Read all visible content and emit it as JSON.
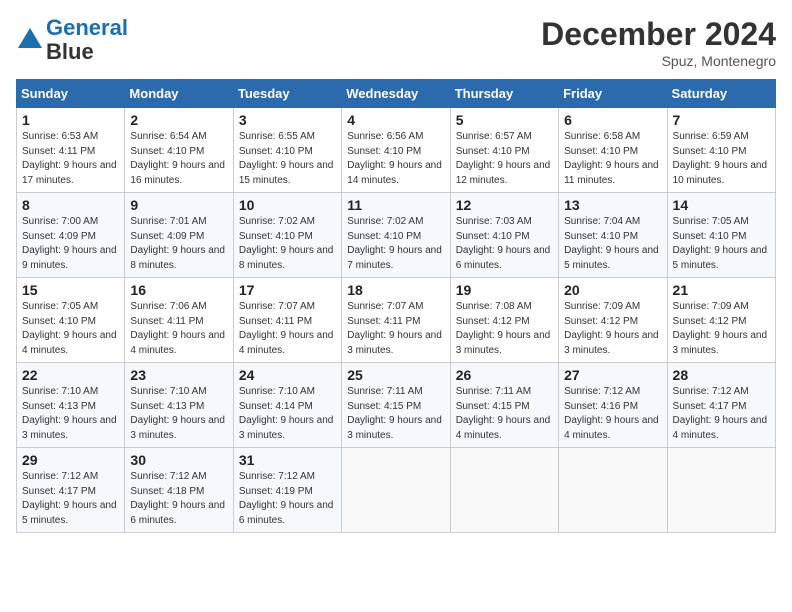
{
  "header": {
    "logo_line1": "General",
    "logo_line2": "Blue",
    "month": "December 2024",
    "location": "Spuz, Montenegro"
  },
  "weekdays": [
    "Sunday",
    "Monday",
    "Tuesday",
    "Wednesday",
    "Thursday",
    "Friday",
    "Saturday"
  ],
  "weeks": [
    [
      {
        "day": "1",
        "sunrise": "6:53 AM",
        "sunset": "4:11 PM",
        "daylight": "9 hours and 17 minutes."
      },
      {
        "day": "2",
        "sunrise": "6:54 AM",
        "sunset": "4:10 PM",
        "daylight": "9 hours and 16 minutes."
      },
      {
        "day": "3",
        "sunrise": "6:55 AM",
        "sunset": "4:10 PM",
        "daylight": "9 hours and 15 minutes."
      },
      {
        "day": "4",
        "sunrise": "6:56 AM",
        "sunset": "4:10 PM",
        "daylight": "9 hours and 14 minutes."
      },
      {
        "day": "5",
        "sunrise": "6:57 AM",
        "sunset": "4:10 PM",
        "daylight": "9 hours and 12 minutes."
      },
      {
        "day": "6",
        "sunrise": "6:58 AM",
        "sunset": "4:10 PM",
        "daylight": "9 hours and 11 minutes."
      },
      {
        "day": "7",
        "sunrise": "6:59 AM",
        "sunset": "4:10 PM",
        "daylight": "9 hours and 10 minutes."
      }
    ],
    [
      {
        "day": "8",
        "sunrise": "7:00 AM",
        "sunset": "4:09 PM",
        "daylight": "9 hours and 9 minutes."
      },
      {
        "day": "9",
        "sunrise": "7:01 AM",
        "sunset": "4:09 PM",
        "daylight": "9 hours and 8 minutes."
      },
      {
        "day": "10",
        "sunrise": "7:02 AM",
        "sunset": "4:10 PM",
        "daylight": "9 hours and 8 minutes."
      },
      {
        "day": "11",
        "sunrise": "7:02 AM",
        "sunset": "4:10 PM",
        "daylight": "9 hours and 7 minutes."
      },
      {
        "day": "12",
        "sunrise": "7:03 AM",
        "sunset": "4:10 PM",
        "daylight": "9 hours and 6 minutes."
      },
      {
        "day": "13",
        "sunrise": "7:04 AM",
        "sunset": "4:10 PM",
        "daylight": "9 hours and 5 minutes."
      },
      {
        "day": "14",
        "sunrise": "7:05 AM",
        "sunset": "4:10 PM",
        "daylight": "9 hours and 5 minutes."
      }
    ],
    [
      {
        "day": "15",
        "sunrise": "7:05 AM",
        "sunset": "4:10 PM",
        "daylight": "9 hours and 4 minutes."
      },
      {
        "day": "16",
        "sunrise": "7:06 AM",
        "sunset": "4:11 PM",
        "daylight": "9 hours and 4 minutes."
      },
      {
        "day": "17",
        "sunrise": "7:07 AM",
        "sunset": "4:11 PM",
        "daylight": "9 hours and 4 minutes."
      },
      {
        "day": "18",
        "sunrise": "7:07 AM",
        "sunset": "4:11 PM",
        "daylight": "9 hours and 3 minutes."
      },
      {
        "day": "19",
        "sunrise": "7:08 AM",
        "sunset": "4:12 PM",
        "daylight": "9 hours and 3 minutes."
      },
      {
        "day": "20",
        "sunrise": "7:09 AM",
        "sunset": "4:12 PM",
        "daylight": "9 hours and 3 minutes."
      },
      {
        "day": "21",
        "sunrise": "7:09 AM",
        "sunset": "4:12 PM",
        "daylight": "9 hours and 3 minutes."
      }
    ],
    [
      {
        "day": "22",
        "sunrise": "7:10 AM",
        "sunset": "4:13 PM",
        "daylight": "9 hours and 3 minutes."
      },
      {
        "day": "23",
        "sunrise": "7:10 AM",
        "sunset": "4:13 PM",
        "daylight": "9 hours and 3 minutes."
      },
      {
        "day": "24",
        "sunrise": "7:10 AM",
        "sunset": "4:14 PM",
        "daylight": "9 hours and 3 minutes."
      },
      {
        "day": "25",
        "sunrise": "7:11 AM",
        "sunset": "4:15 PM",
        "daylight": "9 hours and 3 minutes."
      },
      {
        "day": "26",
        "sunrise": "7:11 AM",
        "sunset": "4:15 PM",
        "daylight": "9 hours and 4 minutes."
      },
      {
        "day": "27",
        "sunrise": "7:12 AM",
        "sunset": "4:16 PM",
        "daylight": "9 hours and 4 minutes."
      },
      {
        "day": "28",
        "sunrise": "7:12 AM",
        "sunset": "4:17 PM",
        "daylight": "9 hours and 4 minutes."
      }
    ],
    [
      {
        "day": "29",
        "sunrise": "7:12 AM",
        "sunset": "4:17 PM",
        "daylight": "9 hours and 5 minutes."
      },
      {
        "day": "30",
        "sunrise": "7:12 AM",
        "sunset": "4:18 PM",
        "daylight": "9 hours and 6 minutes."
      },
      {
        "day": "31",
        "sunrise": "7:12 AM",
        "sunset": "4:19 PM",
        "daylight": "9 hours and 6 minutes."
      },
      null,
      null,
      null,
      null
    ]
  ]
}
